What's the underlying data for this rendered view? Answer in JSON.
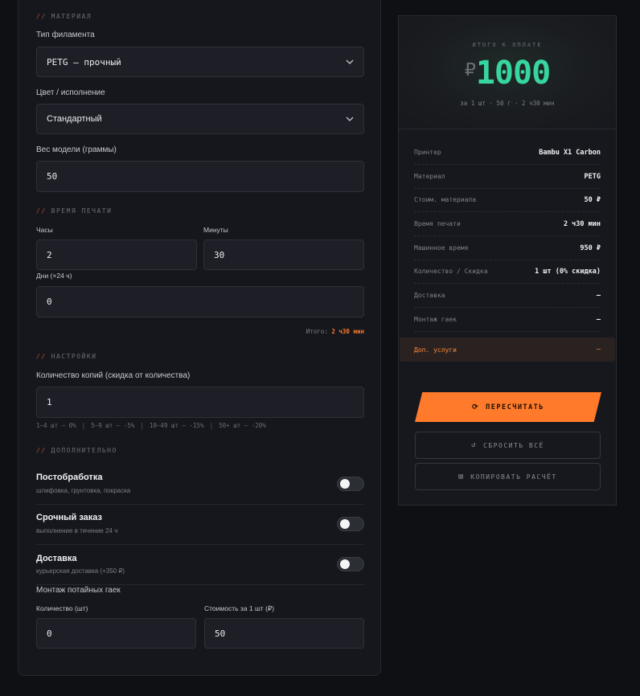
{
  "material": {
    "section_prefix": "//",
    "section_title": "МАТЕРИАЛ",
    "filament_label": "Тип филамента",
    "filament_value": "PETG — прочный",
    "color_label": "Цвет / исполнение",
    "color_value": "Стандартный",
    "weight_label": "Вес модели (граммы)",
    "weight_value": "50"
  },
  "print_time": {
    "section_prefix": "//",
    "section_title": "ВРЕМЯ ПЕЧАТИ",
    "hours_label": "Часы",
    "hours_value": "2",
    "minutes_label": "Минуты",
    "minutes_value": "30",
    "days_label": "Дни (×24 ч)",
    "days_value": "0",
    "total_label": "Итого:",
    "total_value": "2 ч30 мин"
  },
  "settings": {
    "section_prefix": "//",
    "section_title": "НАСТРОЙКИ",
    "copies_label": "Количество копий (скидка от количества)",
    "copies_value": "1",
    "tiers": [
      "1–4 шт — 0%",
      "5–9 шт — -5%",
      "10–49 шт — -15%",
      "50+ шт — -20%"
    ],
    "tier_separator": "|"
  },
  "extras": {
    "section_prefix": "//",
    "section_title": "ДОПОЛНИТЕЛЬНО",
    "toggles": [
      {
        "title": "Постобработка",
        "subtitle": "шлифовка, грунтовка, покраска",
        "on": false
      },
      {
        "title": "Срочный заказ",
        "subtitle": "выполнение в течение 24 ч",
        "on": false
      },
      {
        "title": "Доставка",
        "subtitle": "курьерская доставка (+350 ₽)",
        "on": false
      }
    ],
    "nuts_title": "Монтаж потайных гаек",
    "nuts_qty_label": "Количество (шт)",
    "nuts_qty_value": "0",
    "nuts_price_label": "Стоимость за 1 шт (₽)",
    "nuts_price_value": "50"
  },
  "summary": {
    "caption": "ИТОГО К ОПЛАТЕ",
    "currency": "₽",
    "amount": "1000",
    "subline": "за 1 шт · 50 г · 2 ч30 мин",
    "rows": [
      {
        "k": "Принтер",
        "v": "Bambu X1 Carbon"
      },
      {
        "k": "Материал",
        "v": "PETG"
      },
      {
        "k": "Стоим. материала",
        "v": "50 ₽"
      },
      {
        "k": "Время печати",
        "v": "2 ч30 мин"
      },
      {
        "k": "Машинное время",
        "v": "950 ₽"
      },
      {
        "k": "Количество / Скидка",
        "v": "1 шт (0% скидка)"
      },
      {
        "k": "Доставка",
        "v": "—"
      },
      {
        "k": "Монтаж гаек",
        "v": "—"
      },
      {
        "k": "Доп. услуги",
        "v": "—"
      }
    ],
    "recalc_label": "ПЕРЕСЧИТАТЬ",
    "reset_label": "СБРОСИТЬ ВСЁ",
    "copy_label": "КОПИРОВАТЬ РАСЧЁТ"
  },
  "colors": {
    "accent": "#ff7a2b",
    "price": "#37d69e",
    "background": "#0f1014",
    "panel": "#16171c"
  }
}
